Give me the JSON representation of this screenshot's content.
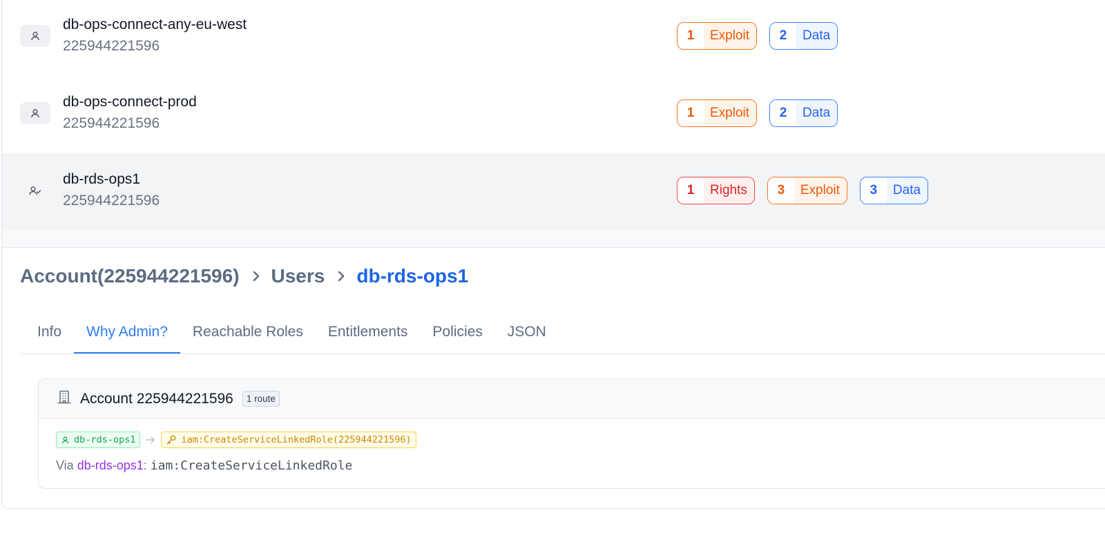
{
  "users": [
    {
      "name": "db-ops-connect-any-eu-west",
      "account": "225944221596",
      "icon": "user-icon",
      "badges": [
        {
          "count": "1",
          "label": "Exploit"
        },
        {
          "count": "2",
          "label": "Data"
        }
      ]
    },
    {
      "name": "db-ops-connect-prod",
      "account": "225944221596",
      "icon": "user-icon",
      "badges": [
        {
          "count": "1",
          "label": "Exploit"
        },
        {
          "count": "2",
          "label": "Data"
        }
      ]
    },
    {
      "name": "db-rds-ops1",
      "account": "225944221596",
      "icon": "user-check-icon",
      "selected": true,
      "badges": [
        {
          "count": "1",
          "label": "Rights"
        },
        {
          "count": "3",
          "label": "Exploit"
        },
        {
          "count": "3",
          "label": "Data"
        }
      ]
    }
  ],
  "breadcrumb": {
    "account": "Account(225944221596)",
    "section": "Users",
    "current": "db-rds-ops1"
  },
  "tabs": [
    {
      "label": "Info"
    },
    {
      "label": "Why Admin?",
      "active": true
    },
    {
      "label": "Reachable Roles"
    },
    {
      "label": "Entitlements"
    },
    {
      "label": "Policies"
    },
    {
      "label": "JSON"
    }
  ],
  "route_card": {
    "title": "Account 225944221596",
    "route_count": "1 route",
    "source_chip": "db-rds-ops1",
    "target_chip": "iam:CreateServiceLinkedRole(225944221596)",
    "via_prefix": "Via ",
    "via_user": "db-rds-ops1",
    "via_colon": ": ",
    "via_permission": "iam:CreateServiceLinkedRole"
  },
  "colors": {
    "exploit": "#ea580c",
    "data": "#2563eb",
    "rights": "#dc2626",
    "active_tab": "#2f7cf0",
    "breadcrumb_current": "#1d64e6"
  }
}
